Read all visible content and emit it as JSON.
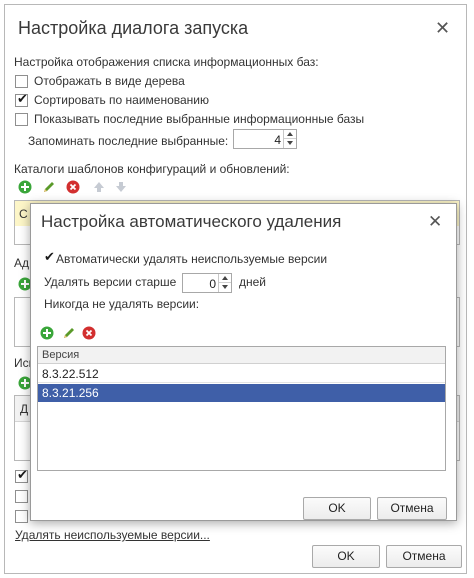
{
  "main": {
    "title": "Настройка диалога запуска",
    "list_settings_label": "Настройка отображения списка информационных баз:",
    "options": [
      {
        "label": "Отображать в виде дерева",
        "checked": false
      },
      {
        "label": "Сортировать по наименованию",
        "checked": true
      },
      {
        "label": "Показывать последние выбранные информационные базы",
        "checked": false
      }
    ],
    "remember_label": "Запоминать последние выбранные:",
    "remember_value": "4",
    "catalogs_label": "Каталоги шаблонов конфигураций и обновлений:",
    "catalog_first_cell": "C",
    "partial_label_1": "Ад",
    "partial_label_2": "Исп",
    "partial_cell": "Д",
    "bottom_checks": [
      true,
      false,
      false
    ],
    "delete_unused_link": "Удалять неиспользуемые версии...",
    "ok_label": "OK",
    "cancel_label": "Отмена"
  },
  "modal": {
    "title": "Настройка автоматического удаления",
    "auto_delete_label": "Автоматически удалять неиспользуемые версии",
    "auto_delete_checked": true,
    "delete_older_label": "Удалять версии старше",
    "delete_older_value": "0",
    "days_label": "дней",
    "never_delete_label": "Никогда не удалять версии:",
    "column_header": "Версия",
    "versions": [
      "8.3.22.512",
      "8.3.21.256"
    ],
    "selected_index": 1,
    "ok_label": "OK",
    "cancel_label": "Отмена"
  },
  "icons": {
    "add": "add-icon",
    "edit": "pencil-icon",
    "delete": "delete-icon",
    "up": "arrow-up-icon",
    "down": "arrow-down-icon",
    "close": "close-icon"
  },
  "colors": {
    "selection": "#3f5fa8",
    "add_green": "#3aa63a",
    "delete_red": "#d22f2f",
    "highlight_yellow": "#fdf6c8"
  }
}
